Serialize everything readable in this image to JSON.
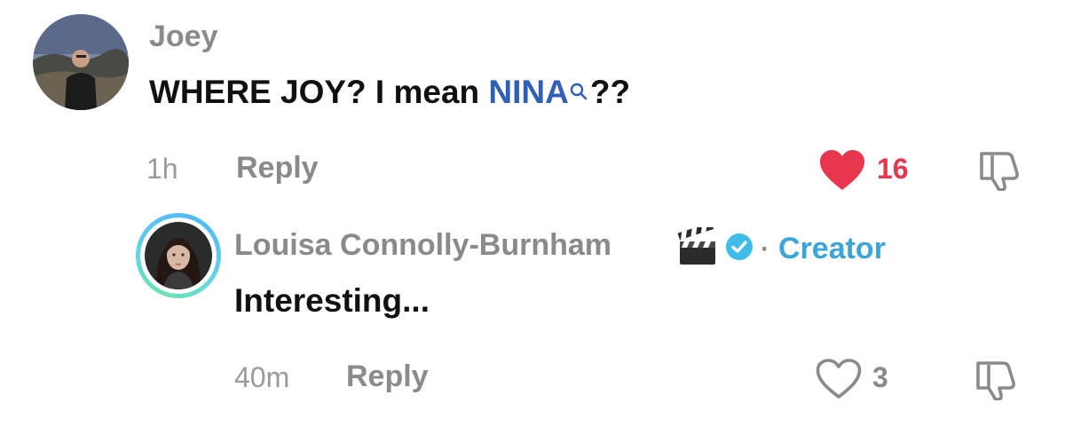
{
  "comments": [
    {
      "username": "Joey",
      "text_before": "WHERE JOY? I mean ",
      "mention": "NINA",
      "text_after": "??",
      "time": "1h",
      "reply_label": "Reply",
      "likes": "16",
      "liked": true
    },
    {
      "username": "Louisa Connolly-Burnham",
      "badge_separator": "·",
      "creator_label": "Creator",
      "text": "Interesting...",
      "time": "40m",
      "reply_label": "Reply",
      "likes": "3",
      "liked": false
    }
  ],
  "icons": {
    "clapperboard": "clapperboard-icon",
    "verified": "verified-badge-icon",
    "heart_filled": "heart-filled-icon",
    "heart_outline": "heart-outline-icon",
    "dislike": "thumbs-down-icon",
    "mention_search": "search-icon"
  },
  "colors": {
    "like_active": "#e8364f",
    "mention": "#2f5fb7",
    "creator": "#3aa5d8",
    "muted": "#8a8a8a",
    "text": "#111111"
  }
}
